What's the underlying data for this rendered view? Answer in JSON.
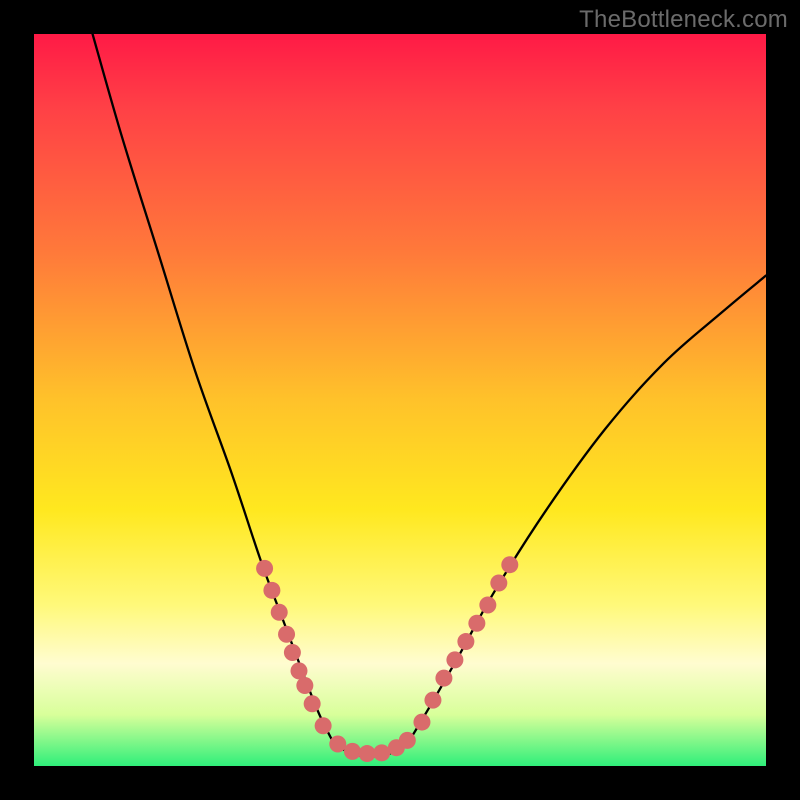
{
  "watermark": "TheBottleneck.com",
  "chart_data": {
    "type": "line",
    "title": "",
    "xlabel": "",
    "ylabel": "",
    "xlim": [
      0,
      100
    ],
    "ylim": [
      0,
      100
    ],
    "grid": false,
    "series": [
      {
        "name": "left-curve",
        "color": "#000000",
        "points": [
          {
            "x": 8,
            "y": 100
          },
          {
            "x": 12,
            "y": 86
          },
          {
            "x": 17,
            "y": 70
          },
          {
            "x": 22,
            "y": 54
          },
          {
            "x": 27,
            "y": 40
          },
          {
            "x": 31,
            "y": 28
          },
          {
            "x": 34,
            "y": 20
          },
          {
            "x": 37,
            "y": 12
          },
          {
            "x": 39,
            "y": 7
          },
          {
            "x": 41,
            "y": 3
          }
        ]
      },
      {
        "name": "valley",
        "color": "#000000",
        "points": [
          {
            "x": 41,
            "y": 3
          },
          {
            "x": 44,
            "y": 1.5
          },
          {
            "x": 48,
            "y": 1.5
          },
          {
            "x": 51,
            "y": 3
          }
        ]
      },
      {
        "name": "right-curve",
        "color": "#000000",
        "points": [
          {
            "x": 51,
            "y": 3
          },
          {
            "x": 54,
            "y": 8
          },
          {
            "x": 58,
            "y": 15
          },
          {
            "x": 63,
            "y": 24
          },
          {
            "x": 70,
            "y": 35
          },
          {
            "x": 78,
            "y": 46
          },
          {
            "x": 86,
            "y": 55
          },
          {
            "x": 94,
            "y": 62
          },
          {
            "x": 100,
            "y": 67
          }
        ]
      }
    ],
    "markers": [
      {
        "x": 31.5,
        "y": 27
      },
      {
        "x": 32.5,
        "y": 24
      },
      {
        "x": 33.5,
        "y": 21
      },
      {
        "x": 34.5,
        "y": 18
      },
      {
        "x": 35.3,
        "y": 15.5
      },
      {
        "x": 36.2,
        "y": 13
      },
      {
        "x": 37.0,
        "y": 11
      },
      {
        "x": 38.0,
        "y": 8.5
      },
      {
        "x": 39.5,
        "y": 5.5
      },
      {
        "x": 41.5,
        "y": 3
      },
      {
        "x": 43.5,
        "y": 2
      },
      {
        "x": 45.5,
        "y": 1.7
      },
      {
        "x": 47.5,
        "y": 1.8
      },
      {
        "x": 49.5,
        "y": 2.5
      },
      {
        "x": 51.0,
        "y": 3.5
      },
      {
        "x": 53.0,
        "y": 6
      },
      {
        "x": 54.5,
        "y": 9
      },
      {
        "x": 56.0,
        "y": 12
      },
      {
        "x": 57.5,
        "y": 14.5
      },
      {
        "x": 59.0,
        "y": 17
      },
      {
        "x": 60.5,
        "y": 19.5
      },
      {
        "x": 62.0,
        "y": 22
      },
      {
        "x": 63.5,
        "y": 25
      },
      {
        "x": 65.0,
        "y": 27.5
      }
    ],
    "marker_color": "#d96b6b",
    "marker_radius_px": 8.5
  }
}
